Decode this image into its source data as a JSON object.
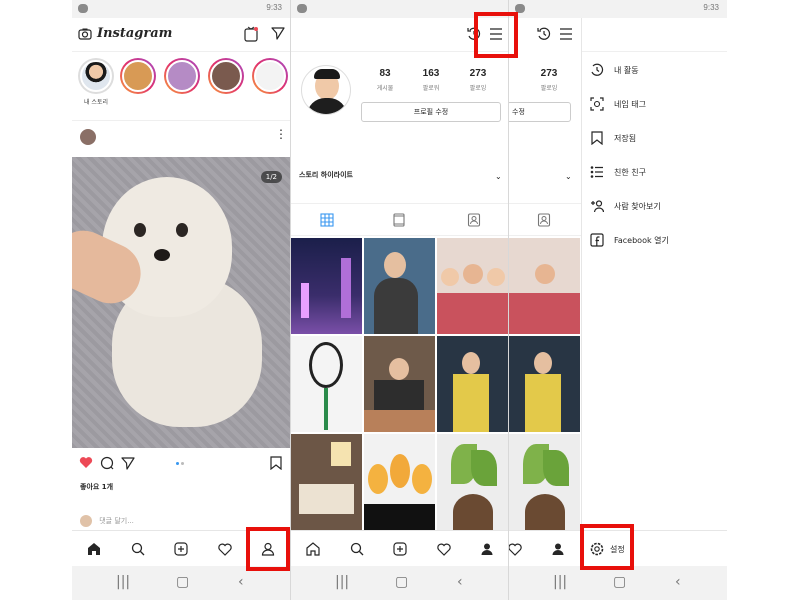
{
  "status": {
    "time": "9:33"
  },
  "feed": {
    "logo": "Instagram",
    "story_label": "내 스토리",
    "photo_counter": "1/2",
    "likes": "좋아요 1개",
    "comment_placeholder": "댓글 달기..."
  },
  "profile": {
    "stats": [
      {
        "value": "83",
        "label": "게시물"
      },
      {
        "value": "163",
        "label": "팔로워"
      },
      {
        "value": "273",
        "label": "팔로잉"
      }
    ],
    "edit_button": "프로필 수정",
    "edit_button_cut": "수정",
    "highlights_label": "스토리 하이라이트"
  },
  "menu": {
    "items": [
      {
        "label": "내 활동",
        "icon": "activity-icon"
      },
      {
        "label": "네임 태그",
        "icon": "nametag-icon"
      },
      {
        "label": "저장됨",
        "icon": "bookmark-icon"
      },
      {
        "label": "친한 친구",
        "icon": "close-friends-icon"
      },
      {
        "label": "사람 찾아보기",
        "icon": "discover-people-icon"
      },
      {
        "label": "Facebook 열기",
        "icon": "facebook-icon"
      }
    ],
    "settings_label": "설정"
  },
  "colors": {
    "highlight": "#e8100b",
    "like": "#ed4956",
    "accent": "#3897f0"
  }
}
